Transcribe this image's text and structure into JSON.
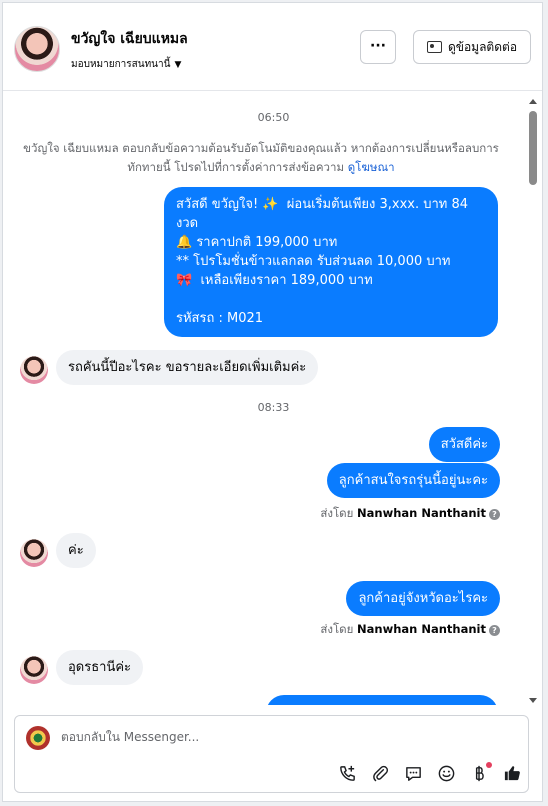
{
  "header": {
    "contact_name": "ขวัญใจ เฉียบแหมล",
    "assign_label": "มอบหมายการสนทนานี้",
    "more_label": "···",
    "contact_info_label": "ดูข้อมูลติดต่อ"
  },
  "messages": {
    "time_1": "06:50",
    "system_note": "ขวัญใจ เฉียบแหมล ตอบกลับข้อความต้อนรับอัตโนมัติของคุณแล้ว หากต้องการเปลี่ยนหรือลบการทักทายนี้ โปรดไปที่การตั้งค่าการส่งข้อความ",
    "system_link": "ดูโฆษณา",
    "promo_bubble": "สวัสดี ขวัญใจ! ✨  ผ่อนเริ่มต้นเพียง 3,xxx. บาท 84 งวด\n🔔 ราคาปกติ 199,000 บาท\n** โปรโมชั่นข้าวแลกลด รับส่วนลด 10,000 บาท\n🎀  เหลือเพียงราคา 189,000 บาท\n\nรหัสรถ : M021",
    "in_1": "รถคันนี้ปีอะไรคะ ขอรายละเอียดเพิ่มเติมค่ะ",
    "time_2": "08:33",
    "out_1": "สวัสดีค่ะ",
    "out_2": "ลูกค้าสนใจรถรุ่นนี้อยู่นะคะ",
    "sent_by_prefix": "ส่งโดย",
    "sent_by_name": "Nanwhan Nanthanit",
    "in_2": "ค่ะ",
    "out_3": "ลูกค้าอยู่จังหวัดอะไรคะ",
    "in_3": "อุดรธานีค่ะ"
  },
  "composer": {
    "placeholder": "ตอบกลับใน Messenger..."
  },
  "colors": {
    "outgoing_bubble": "#0a7cff",
    "incoming_bubble": "#f0f2f5",
    "link": "#1a62d6"
  },
  "icons": [
    "phone-plus-icon",
    "attachment-icon",
    "saved-reply-icon",
    "emoji-icon",
    "baht-icon",
    "like-icon"
  ]
}
